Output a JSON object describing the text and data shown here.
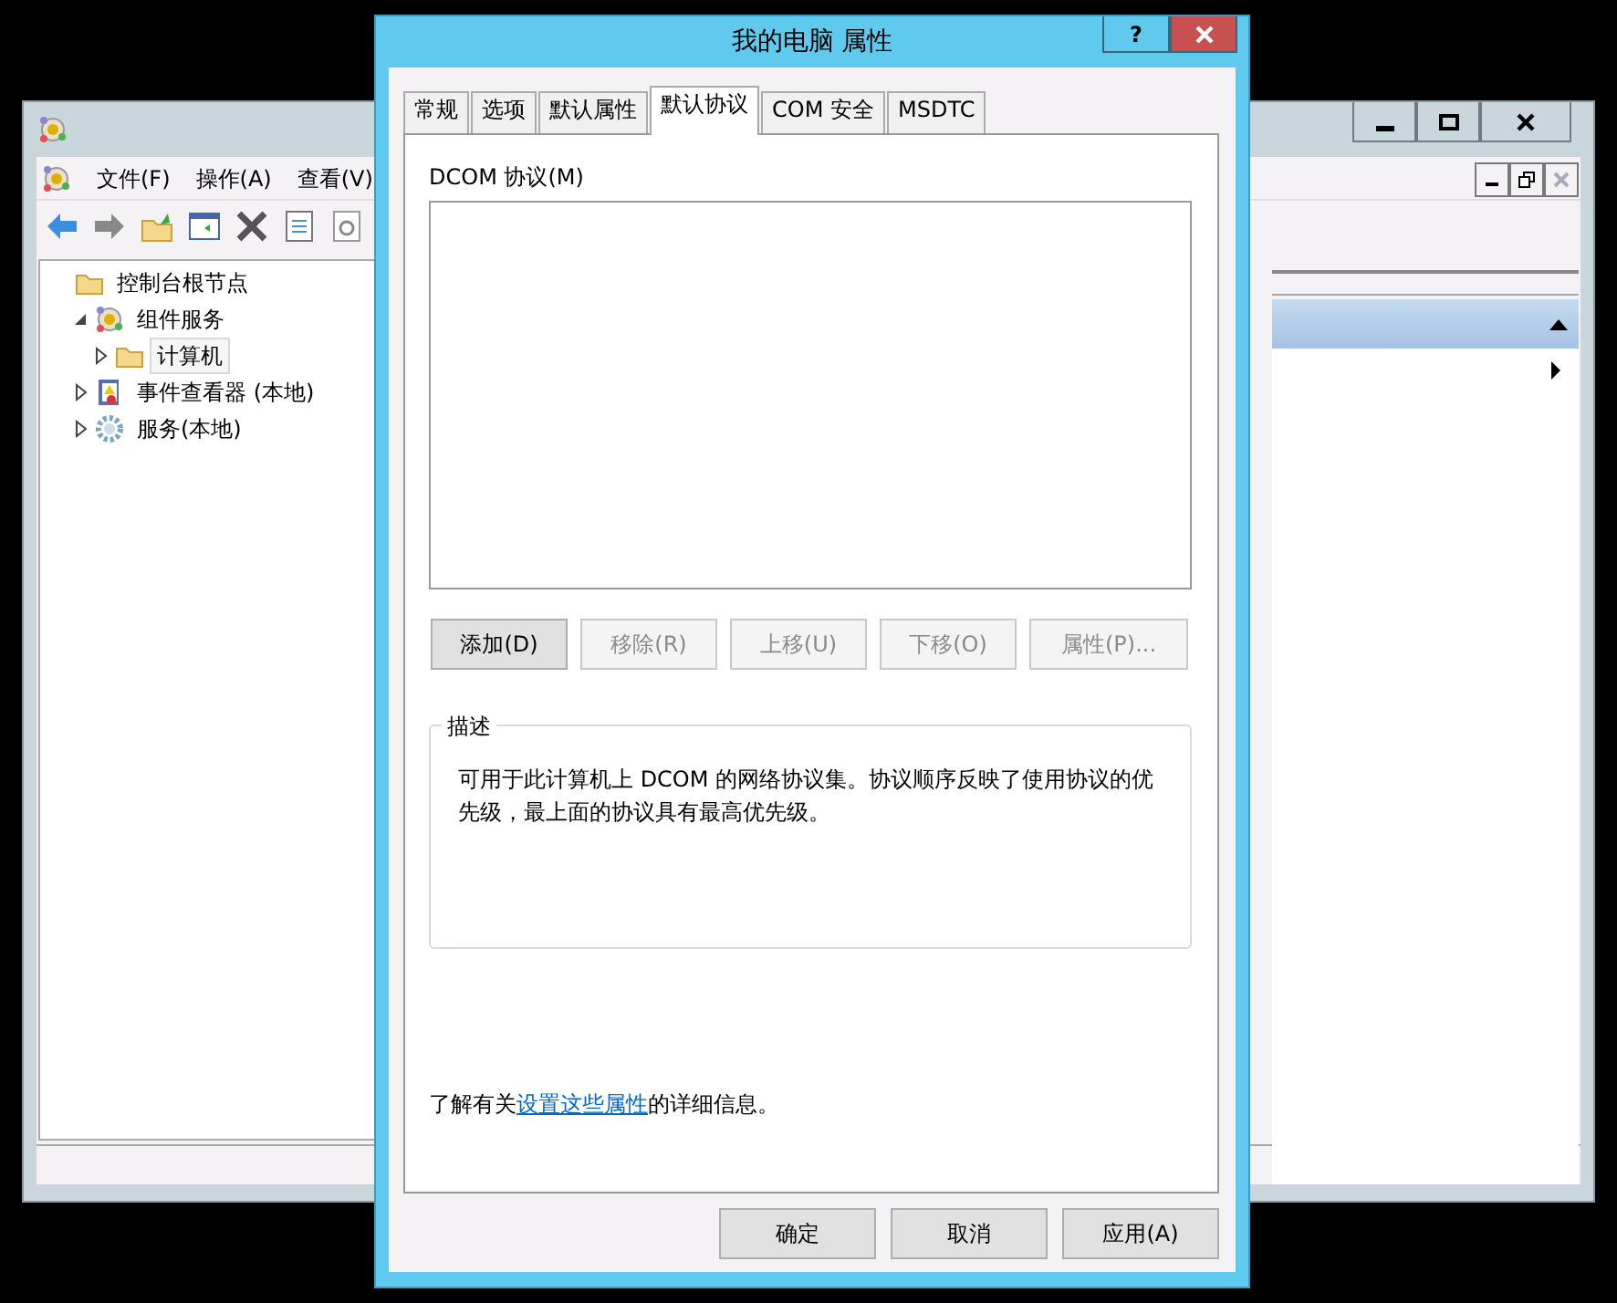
{
  "back_window": {
    "menu": [
      "文件(F)",
      "操作(A)",
      "查看(V)"
    ],
    "tree": [
      {
        "label": "控制台根节点",
        "kind": "folder",
        "selected": false,
        "children": [
          {
            "label": "组件服务",
            "kind": "component",
            "expanded": true,
            "selected": false,
            "children": [
              {
                "label": "计算机",
                "kind": "folder",
                "expanded": false,
                "selected": true
              }
            ]
          },
          {
            "label": "事件查看器 (本地)",
            "kind": "event",
            "expanded": false,
            "selected": false
          },
          {
            "label": "服务(本地)",
            "kind": "gear",
            "expanded": false,
            "selected": false
          }
        ]
      }
    ]
  },
  "dialog": {
    "title": "我的电脑 属性",
    "help": "?",
    "tabs": [
      {
        "label": "常规",
        "selected": false
      },
      {
        "label": "选项",
        "selected": false
      },
      {
        "label": "默认属性",
        "selected": false
      },
      {
        "label": "默认协议",
        "selected": true
      },
      {
        "label": "COM 安全",
        "selected": false
      },
      {
        "label": "MSDTC",
        "selected": false
      }
    ],
    "list_label": "DCOM 协议(M)",
    "buttons": [
      {
        "label": "添加(D)",
        "disabled": false
      },
      {
        "label": "移除(R)",
        "disabled": true
      },
      {
        "label": "上移(U)",
        "disabled": true
      },
      {
        "label": "下移(O)",
        "disabled": true
      },
      {
        "label": "属性(P)...",
        "disabled": true
      }
    ],
    "description": {
      "title": "描述",
      "text": "可用于此计算机上 DCOM 的网络协议集。协议顺序反映了使用协议的优先级，最上面的协议具有最高优先级。"
    },
    "info": {
      "before": "了解有关",
      "link": "设置这些属性",
      "after": "的详细信息。"
    },
    "footer_buttons": [
      "确定",
      "取消",
      "应用(A)"
    ]
  }
}
